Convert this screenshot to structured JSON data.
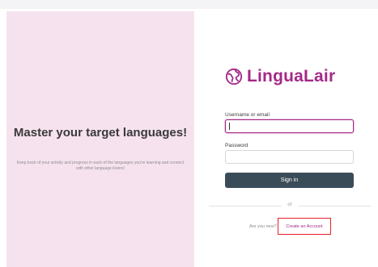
{
  "promo": {
    "headline": "Master your target languages!",
    "subtext": "Keep track of your activity and progress in each of the languages you're learning and connect with other language lovers!"
  },
  "brand": {
    "name": "LinguaLair",
    "icon": "globe-icon",
    "color": "#a32a86"
  },
  "login": {
    "username_label": "Username or email",
    "username_value": "",
    "password_label": "Password",
    "password_value": "",
    "signin_label": "Sign in",
    "divider_text": "or",
    "signup_prompt": "Are you new?",
    "signup_link": "Create an Account"
  },
  "colors": {
    "left_panel_bg": "#f6e2ee",
    "signin_bg": "#3b4c59",
    "highlight_border": "#e8202a"
  }
}
